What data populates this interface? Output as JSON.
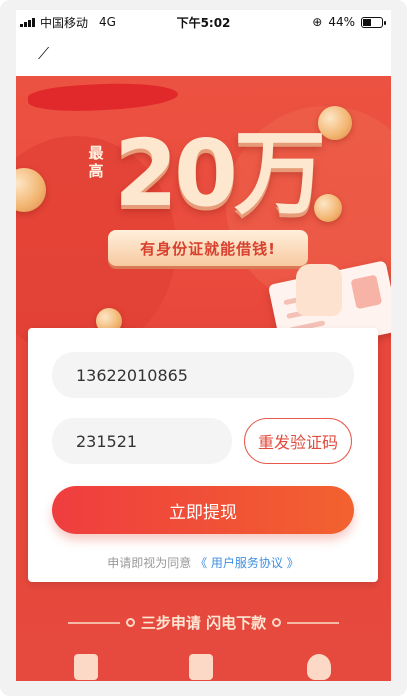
{
  "status_bar": {
    "carrier": "中国移动",
    "network": "4G",
    "time": "下午5:02",
    "battery": "44%"
  },
  "banner": {
    "max_label": "最高",
    "amount": "20万",
    "tagline": "有身份证就能借钱!"
  },
  "form": {
    "phone_value": "13622010865",
    "code_value": "231521",
    "resend_label": "重发验证码",
    "submit_label": "立即提现",
    "agreement_prefix": "申请即视为同意",
    "agreement_link": "《 用户服务协议 》"
  },
  "steps": {
    "title": "三步申请 闪电下款"
  },
  "colors": {
    "brand_red": "#e8473b",
    "button_start": "#ef3d3f",
    "button_end": "#f2622f",
    "link_blue": "#3e8fe0"
  },
  "icons": [
    "back-arrow-icon",
    "signal-icon",
    "battery-icon",
    "lock-rotation-icon",
    "document-icon",
    "form-edit-icon",
    "money-bag-icon"
  ]
}
